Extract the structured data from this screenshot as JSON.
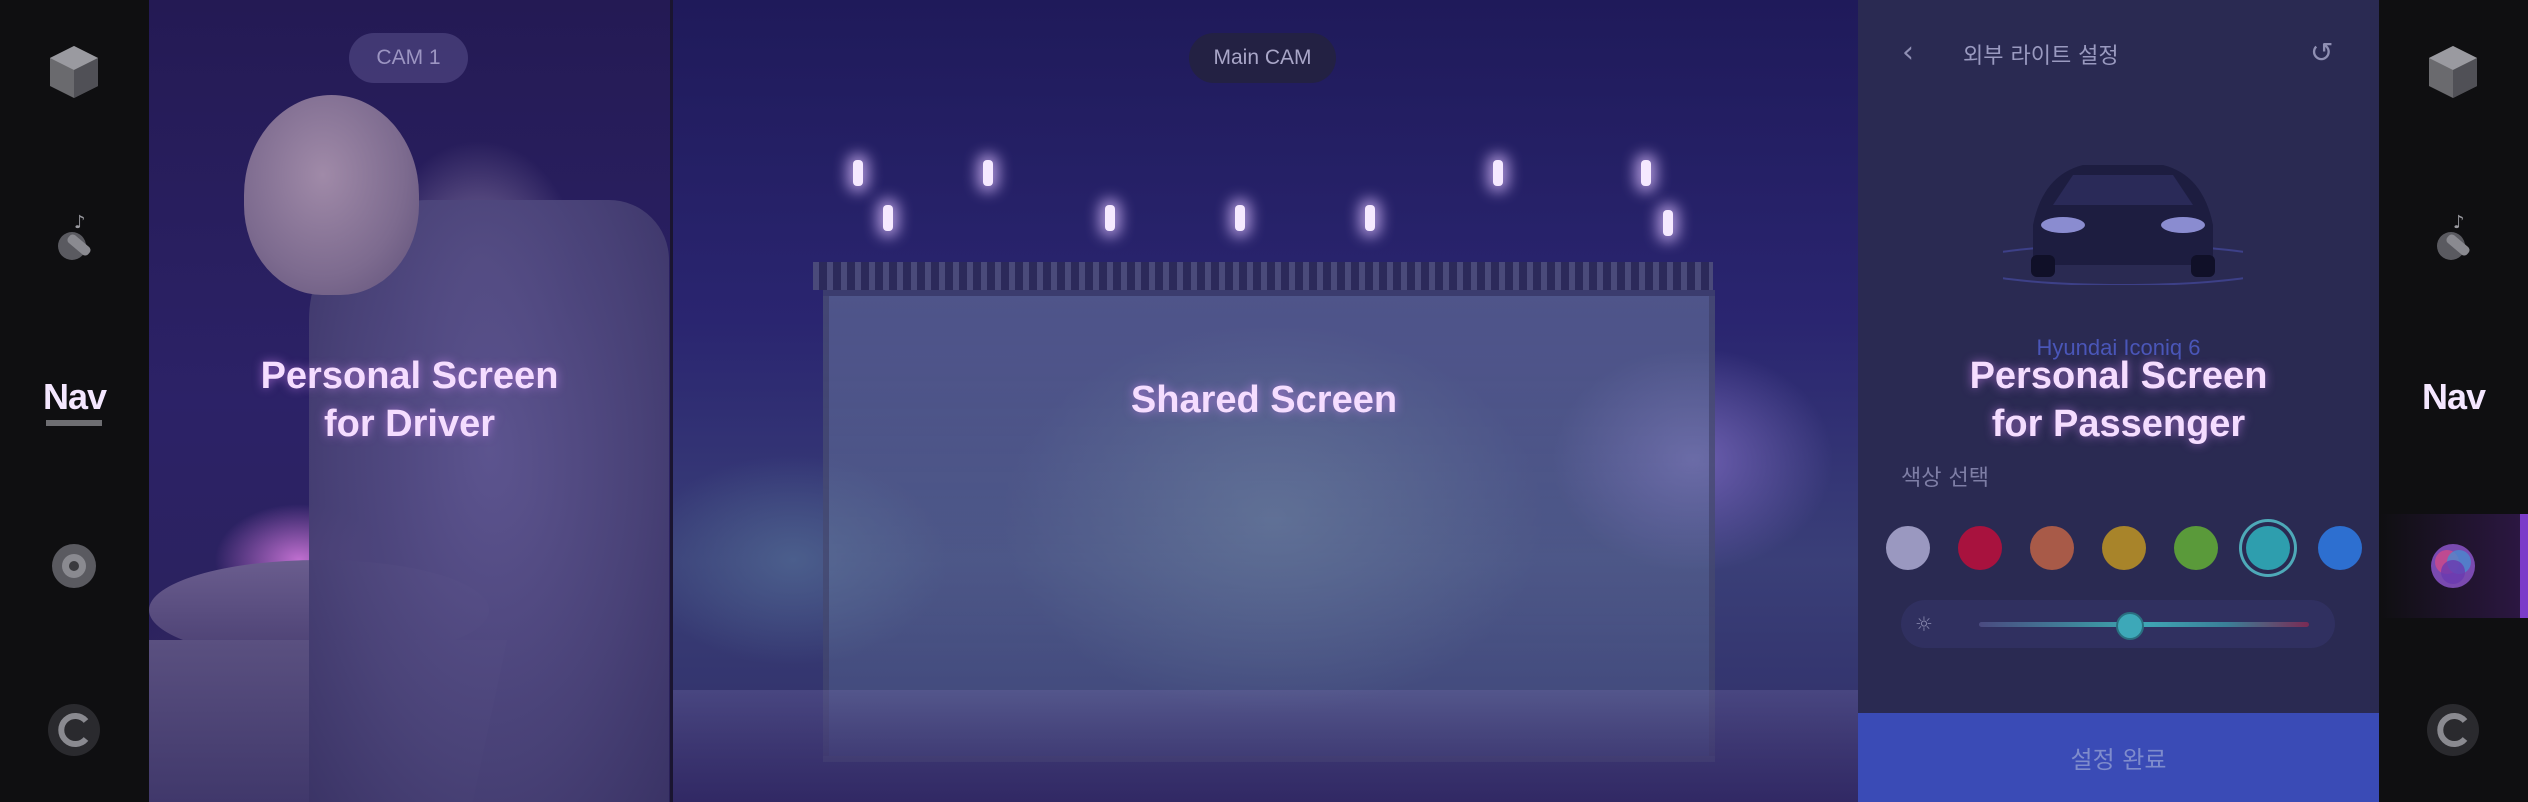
{
  "left_rail": {
    "icons": [
      "box-icon",
      "music-note-icon",
      "layers-icon",
      "cplay-icon"
    ],
    "nav_label": "Nav"
  },
  "right_rail": {
    "icons": [
      "box-icon",
      "music-note-icon",
      "layers-icon",
      "cplay-icon"
    ],
    "nav_label": "Nav",
    "active_item": "layers-icon"
  },
  "driver_panel": {
    "camera_chip": "CAM 1",
    "overlay_line1": "Personal Screen",
    "overlay_line2": "for Driver"
  },
  "shared_panel": {
    "camera_chip": "Main CAM",
    "overlay": "Shared Screen"
  },
  "passenger_panel": {
    "title": "외부 라이트 설정",
    "car_name": "Hyundai Iconiq 6",
    "overlay_line1": "Personal Screen",
    "overlay_line2": "for Passenger",
    "color_section_title": "색상 선택",
    "swatches": [
      {
        "name": "lavender",
        "color": "#9a98c0"
      },
      {
        "name": "red",
        "color": "#a8123e"
      },
      {
        "name": "orange",
        "color": "#a85a48"
      },
      {
        "name": "gold",
        "color": "#a8842a"
      },
      {
        "name": "green",
        "color": "#5a9a3a"
      },
      {
        "name": "teal",
        "color": "#2e9eae"
      },
      {
        "name": "blue",
        "color": "#2d6fd0"
      },
      {
        "name": "indigo",
        "color": "#3a3ac8"
      }
    ],
    "selected_swatch": "teal",
    "brightness_level": 0.45,
    "confirm_label": "설정 완료"
  },
  "colors": {
    "accent": "#7b3cc9",
    "confirm_bg": "#3a4bb6",
    "selection_ring": "#4ea9b8"
  }
}
